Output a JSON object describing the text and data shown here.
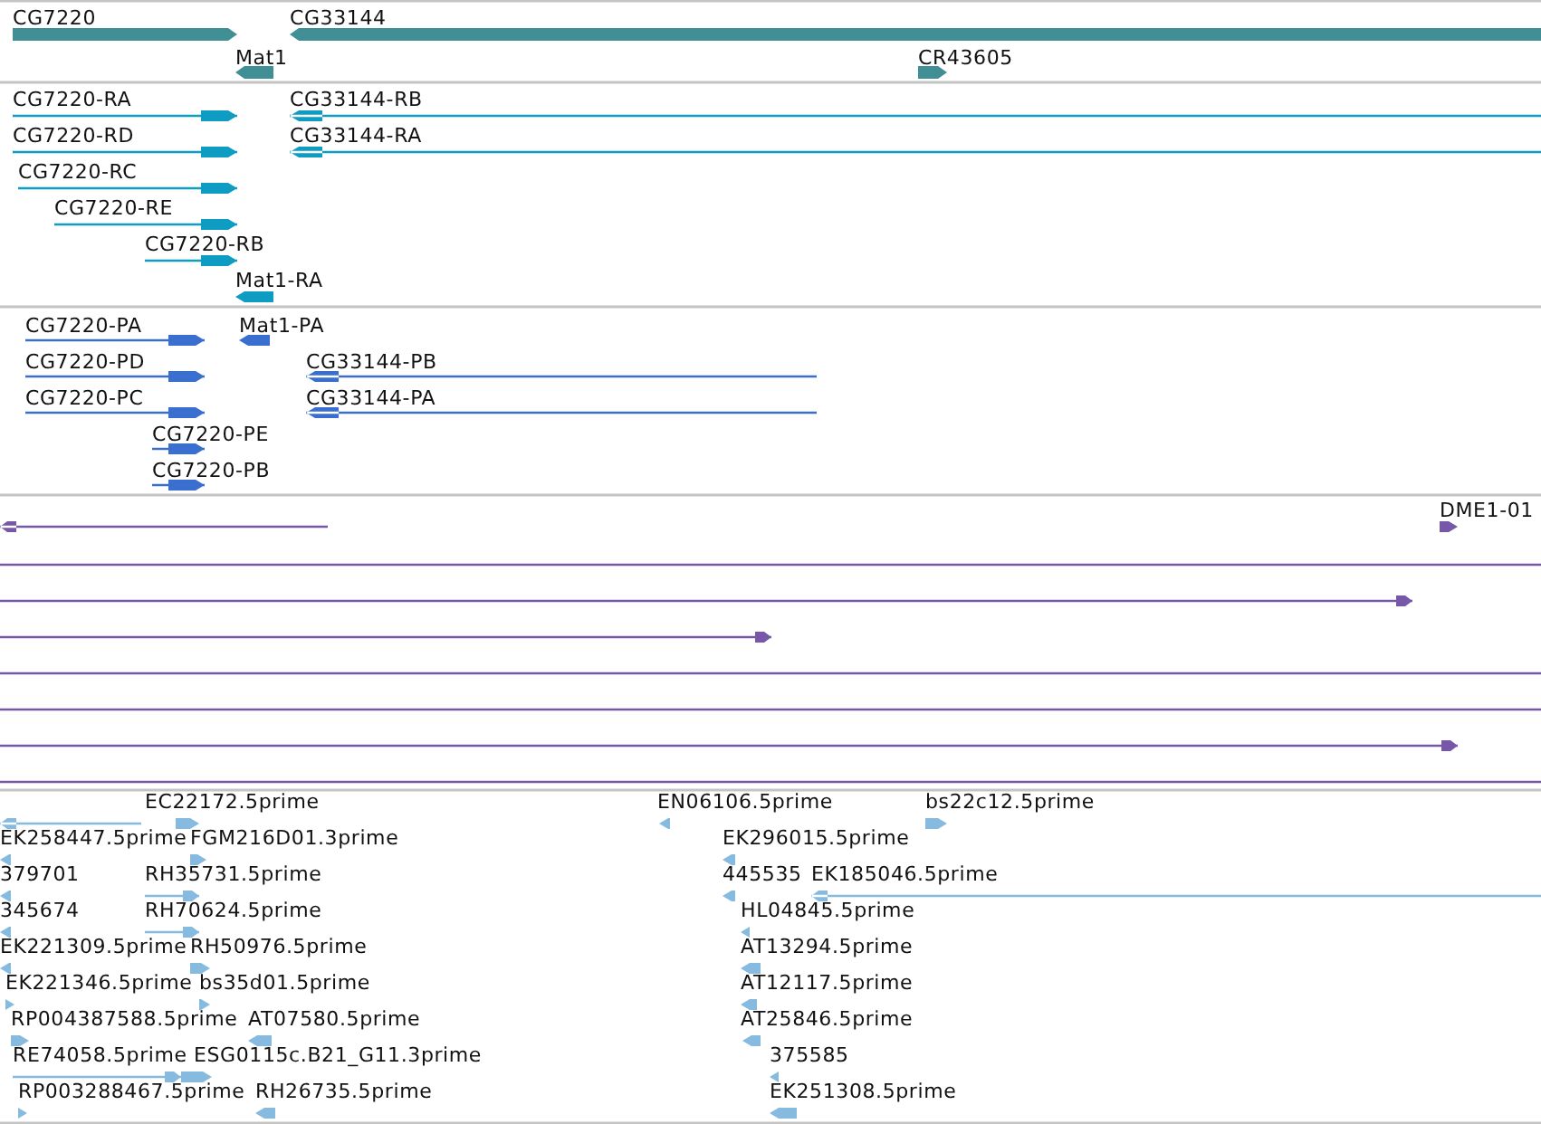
{
  "tracks": [
    {
      "kind": "gene",
      "features": [
        {
          "label": "CG7220",
          "reverse": false
        },
        {
          "label": "CG33144",
          "reverse": true
        },
        {
          "label": "Mat1",
          "reverse": true
        },
        {
          "label": "CR43605",
          "reverse": false
        }
      ]
    },
    {
      "kind": "transcript",
      "features": [
        {
          "label": "CG7220-RA",
          "reverse": false
        },
        {
          "label": "CG33144-RB",
          "reverse": true
        },
        {
          "label": "CG7220-RD",
          "reverse": false
        },
        {
          "label": "CG33144-RA",
          "reverse": true
        },
        {
          "label": "CG7220-RC",
          "reverse": false
        },
        {
          "label": "CG7220-RE",
          "reverse": false
        },
        {
          "label": "CG7220-RB",
          "reverse": false
        },
        {
          "label": "Mat1-RA",
          "reverse": true
        }
      ]
    },
    {
      "kind": "protein",
      "features": [
        {
          "label": "CG7220-PA",
          "reverse": false
        },
        {
          "label": "Mat1-PA",
          "reverse": true
        },
        {
          "label": "CG7220-PD",
          "reverse": false
        },
        {
          "label": "CG33144-PB",
          "reverse": true
        },
        {
          "label": "CG7220-PC",
          "reverse": false
        },
        {
          "label": "CG33144-PA",
          "reverse": true
        },
        {
          "label": "CG7220-PE",
          "reverse": false
        },
        {
          "label": "CG7220-PB",
          "reverse": false
        }
      ]
    },
    {
      "kind": "alignment",
      "features": [
        {
          "reverse": true
        },
        {
          "label": "DME1-01",
          "reverse": false
        },
        {
          "headless": true
        },
        {
          "reverse": false
        },
        {
          "reverse": false
        },
        {
          "headless": true
        },
        {
          "headless": true
        },
        {
          "reverse": false
        },
        {
          "headless": true
        }
      ]
    },
    {
      "kind": "est",
      "features": [
        {
          "reverse": true
        },
        {
          "label": "EC22172.5prime",
          "reverse": false
        },
        {
          "label": "EN06106.5prime",
          "reverse": true
        },
        {
          "label": "bs22c12.5prime",
          "reverse": false
        },
        {
          "label": "EK258447.5prime",
          "reverse": true
        },
        {
          "label": "FGM216D01.3prime",
          "reverse": false
        },
        {
          "label": "EK296015.5prime",
          "reverse": true
        },
        {
          "label": "379701",
          "reverse": true
        },
        {
          "label": "RH35731.5prime",
          "reverse": false
        },
        {
          "label": "445535",
          "reverse": true
        },
        {
          "label": "EK185046.5prime",
          "reverse": true
        },
        {
          "label": "345674",
          "reverse": true
        },
        {
          "label": "RH70624.5prime",
          "reverse": false
        },
        {
          "label": "HL04845.5prime",
          "reverse": true
        },
        {
          "label": "EK221309.5prime",
          "reverse": true
        },
        {
          "label": "RH50976.5prime",
          "reverse": false
        },
        {
          "label": "AT13294.5prime",
          "reverse": true
        },
        {
          "label": "EK221346.5prime",
          "reverse": false
        },
        {
          "label": "bs35d01.5prime",
          "reverse": false
        },
        {
          "label": "AT12117.5prime",
          "reverse": true
        },
        {
          "label": "RP004387588.5prime",
          "reverse": false
        },
        {
          "label": "AT07580.5prime",
          "reverse": true
        },
        {
          "label": "AT25846.5prime",
          "reverse": true
        },
        {
          "label": "RE74058.5prime",
          "reverse": false
        },
        {
          "label": "ESG0115c.B21_G11.3prime",
          "reverse": false
        },
        {
          "label": "375585",
          "reverse": true
        },
        {
          "label": "RP003288467.5prime",
          "reverse": false
        },
        {
          "label": "RH26735.5prime",
          "reverse": true
        },
        {
          "label": "EK251308.5prime",
          "reverse": true
        }
      ]
    }
  ]
}
